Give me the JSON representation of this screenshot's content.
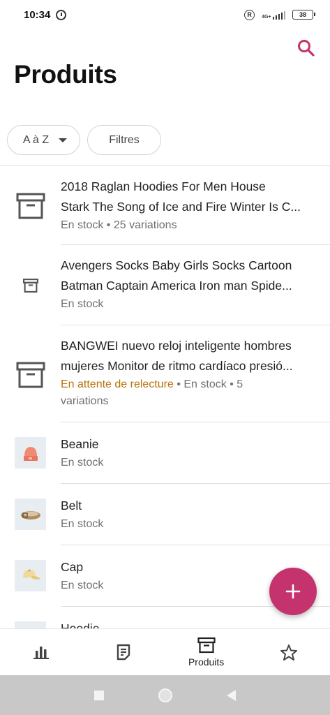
{
  "status_bar": {
    "time": "10:34",
    "network": "4G+",
    "battery": "38"
  },
  "header": {
    "title": "Produits"
  },
  "filters": {
    "sort_label": "A à Z",
    "filter_label": "Filtres"
  },
  "products": [
    {
      "name_line1": "2018 Raglan Hoodies For Men House",
      "name_line2": "Stark The Song of Ice and Fire Winter Is C...",
      "status": "",
      "meta": "En stock • 25 variations",
      "icon": "archive-icon"
    },
    {
      "name_line1": "Avengers Socks Baby Girls Socks Cartoon",
      "name_line2": "Batman Captain America Iron man Spide...",
      "status": "",
      "meta": "En stock",
      "icon": "archive-icon"
    },
    {
      "name_line1": "BANGWEI nuevo reloj inteligente hombres",
      "name_line2": "mujeres Monitor de ritmo cardíaco presió...",
      "status": "En attente de relecture",
      "meta": " • En stock • 5",
      "meta_line2": "variations",
      "icon": "archive-icon"
    },
    {
      "name": "Beanie",
      "meta": "En stock",
      "icon": "beanie-icon"
    },
    {
      "name": "Belt",
      "meta": "En stock",
      "icon": "belt-icon"
    },
    {
      "name": "Cap",
      "meta": "En stock",
      "icon": "cap-icon"
    },
    {
      "name": "Hoodie",
      "meta": "",
      "icon": "hoodie-icon"
    }
  ],
  "bottom_nav": {
    "items": [
      {
        "icon": "bar-chart-icon",
        "label": ""
      },
      {
        "icon": "orders-icon",
        "label": ""
      },
      {
        "icon": "archive-icon",
        "label": "Produits"
      },
      {
        "icon": "star-icon",
        "label": ""
      }
    ]
  },
  "colors": {
    "accent": "#c4336e",
    "warning": "#b8730b",
    "text_secondary": "#707070"
  }
}
